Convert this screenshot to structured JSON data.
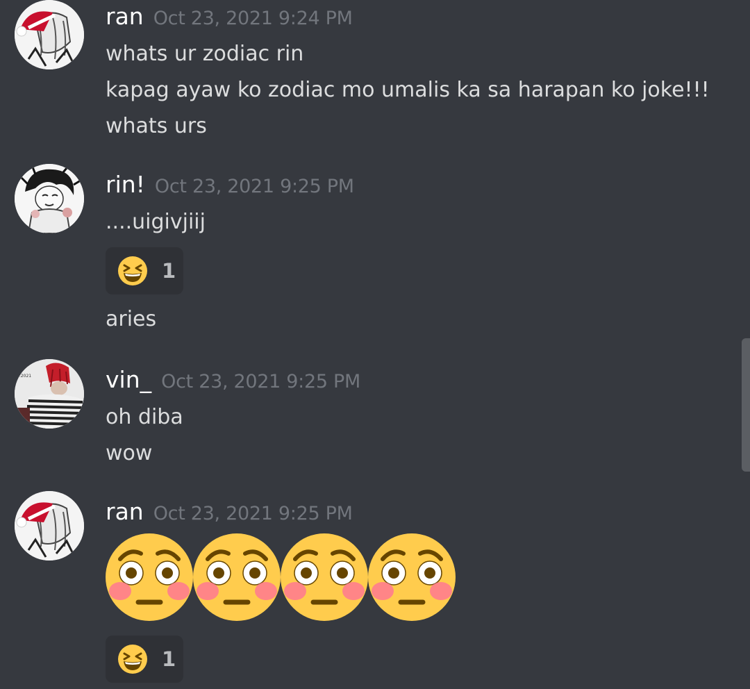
{
  "messages": [
    {
      "username": "ran",
      "timestamp": "Oct 23, 2021 9:24 PM",
      "lines": [
        "whats ur zodiac rin",
        "kapag ayaw ko zodiac mo umalis ka sa harapan ko joke!!!",
        "whats urs"
      ]
    },
    {
      "username": "rin!",
      "timestamp": "Oct 23, 2021 9:25 PM",
      "lines": [
        "....uigivjiij"
      ],
      "reaction": {
        "emoji": "laughing-face",
        "count": "1"
      },
      "after_lines": [
        "aries"
      ]
    },
    {
      "username": "vin_",
      "timestamp": "Oct 23, 2021 9:25 PM",
      "lines": [
        "oh diba",
        "wow"
      ]
    },
    {
      "username": "ran",
      "timestamp": "Oct 23, 2021 9:25 PM",
      "big_emojis": [
        "flushed-face",
        "flushed-face",
        "flushed-face",
        "flushed-face"
      ],
      "reaction": {
        "emoji": "laughing-face",
        "count": "1"
      }
    }
  ],
  "colors": {
    "background": "#36393f",
    "username": "#ffffff",
    "timestamp": "#72767d",
    "text": "#dcddde",
    "reaction_bg": "#2f3136",
    "emoji_yellow": "#ffcc4d"
  }
}
